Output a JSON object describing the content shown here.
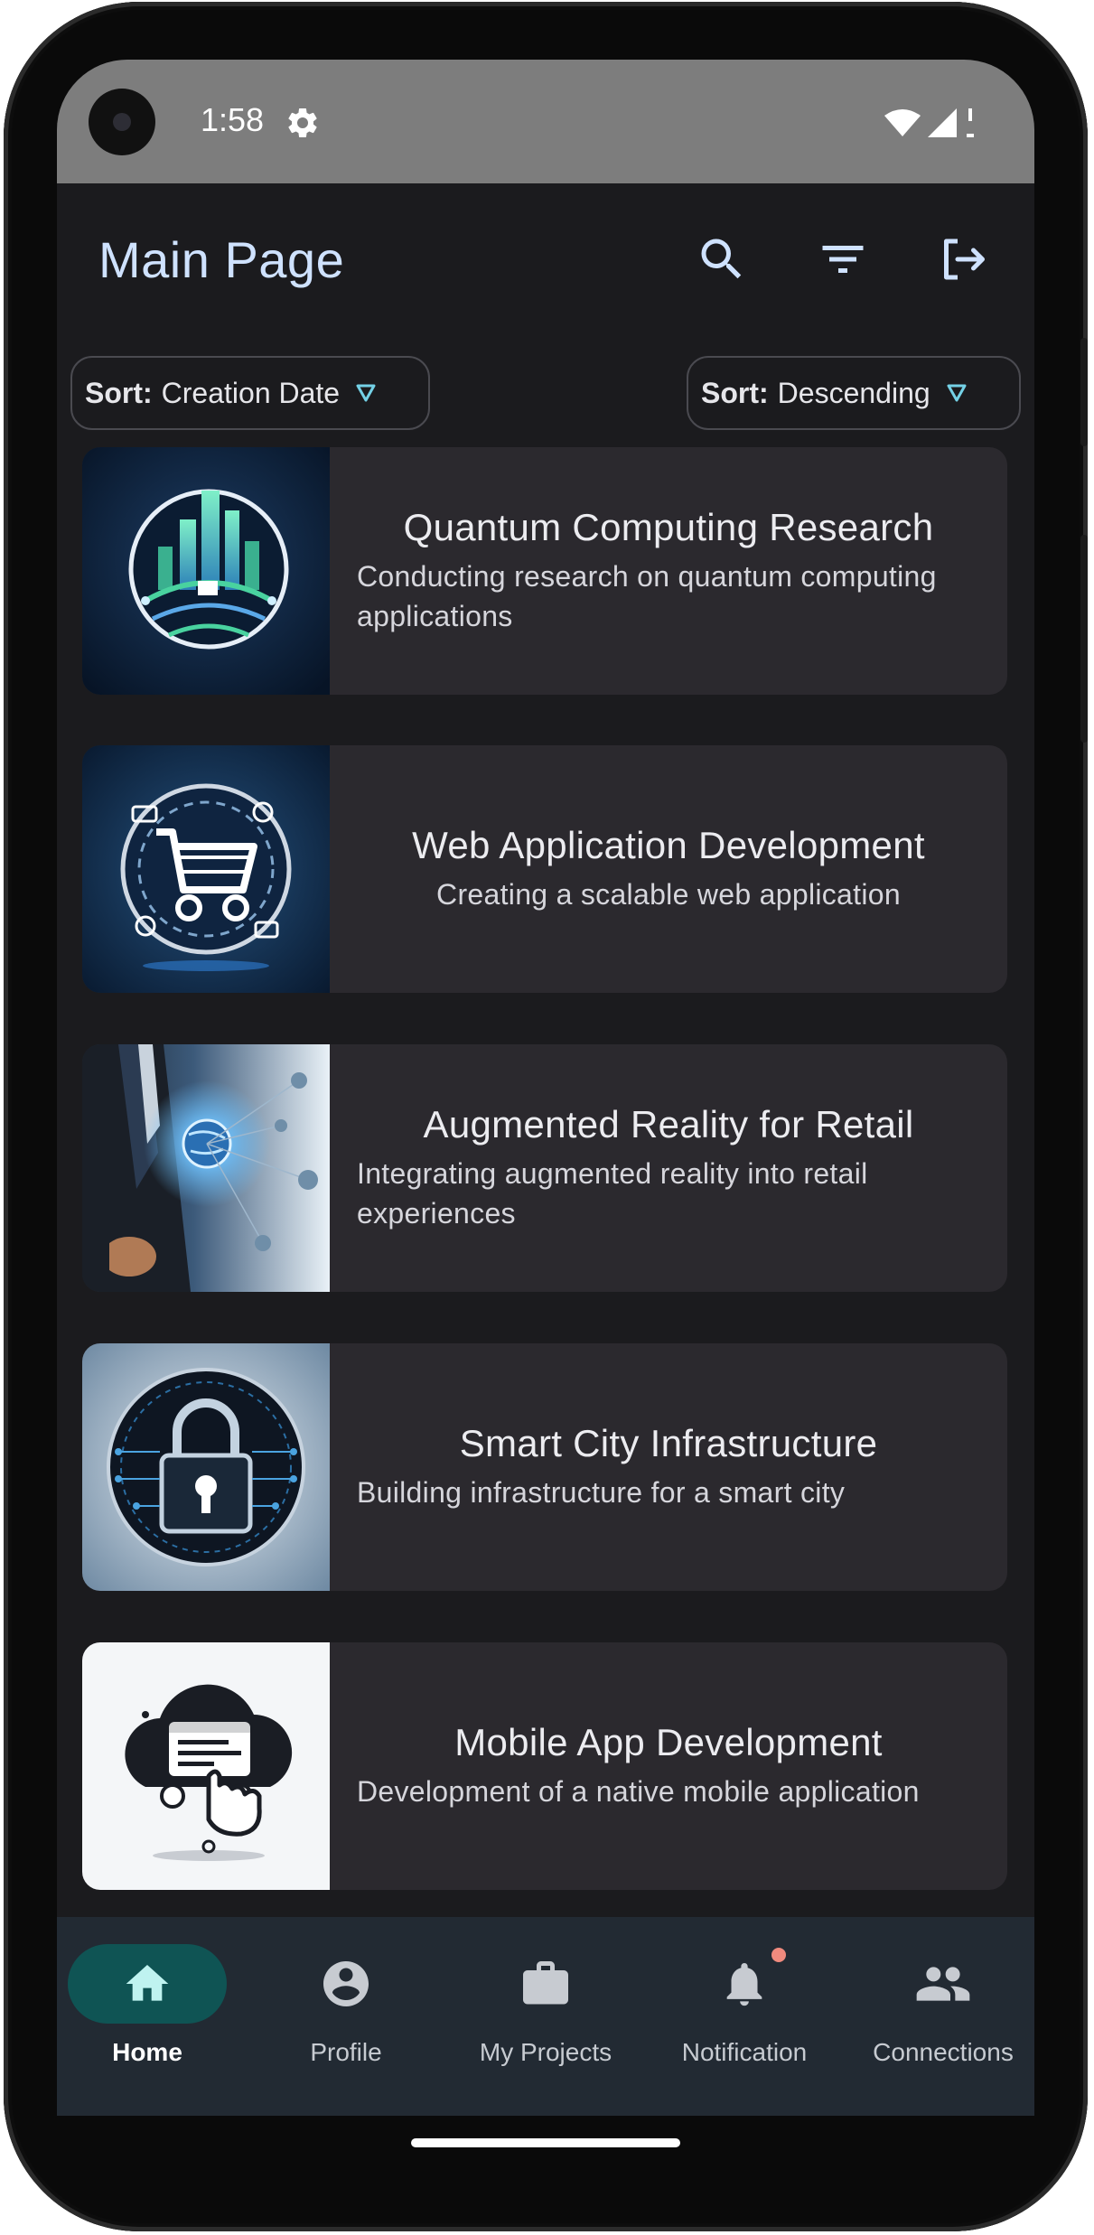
{
  "status_bar": {
    "time": "1:58"
  },
  "header": {
    "title": "Main Page"
  },
  "sort": {
    "left": {
      "prefix": "Sort:",
      "value": "Creation Date"
    },
    "right": {
      "prefix": "Sort:",
      "value": "Descending"
    }
  },
  "projects": [
    {
      "title": "Quantum Computing Research",
      "description": "Conducting research on quantum computing applications"
    },
    {
      "title": "Web Application Development",
      "description": "Creating a scalable web application"
    },
    {
      "title": "Augmented Reality for Retail",
      "description": "Integrating augmented reality into retail experiences"
    },
    {
      "title": "Smart City Infrastructure",
      "description": "Building infrastructure for a smart city"
    },
    {
      "title": "Mobile App Development",
      "description": "Development of a native mobile application"
    }
  ],
  "nav": [
    {
      "label": "Home",
      "icon": "home-icon",
      "active": true
    },
    {
      "label": "Profile",
      "icon": "account-circle-icon"
    },
    {
      "label": "My Projects",
      "icon": "briefcase-icon"
    },
    {
      "label": "Notification",
      "icon": "bell-icon"
    },
    {
      "label": "Connections",
      "icon": "people-icon"
    }
  ],
  "colors": {
    "background": "#1b1b1e",
    "card": "#2b292e",
    "title": "#cfe2ff",
    "nav_active": "#0f5454",
    "nav_background": "#222a33",
    "notification_dot": "#f08a7e",
    "chip_triangle": "#74d1e6"
  }
}
